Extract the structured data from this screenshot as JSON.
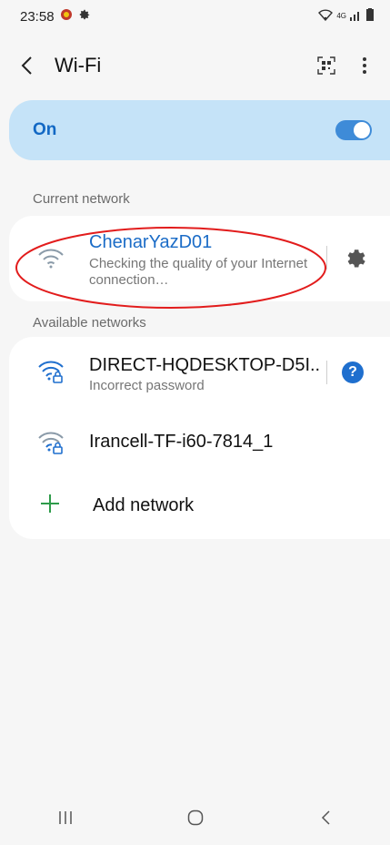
{
  "status_bar": {
    "time": "23:58",
    "network_label": "4G"
  },
  "app_bar": {
    "title": "Wi-Fi"
  },
  "wifi_toggle": {
    "label": "On",
    "enabled": true
  },
  "current_network": {
    "section_label": "Current network",
    "name": "ChenarYazD01",
    "status": "Checking the quality of your Internet connection…"
  },
  "available_networks": {
    "section_label": "Available networks",
    "items": [
      {
        "name": "DIRECT-HQDESKTOP-D5I..",
        "status": "Incorrect password",
        "icon": "wifi-lock-icon"
      },
      {
        "name": "Irancell-TF-i60-7814_1",
        "status": "",
        "icon": "wifi-lock-icon"
      }
    ],
    "add_label": "Add network"
  },
  "colors": {
    "accent": "#1268c4",
    "toggle_bg": "#c5e3f8",
    "annotation": "#e21c1c",
    "add_plus": "#2e9b4a"
  }
}
